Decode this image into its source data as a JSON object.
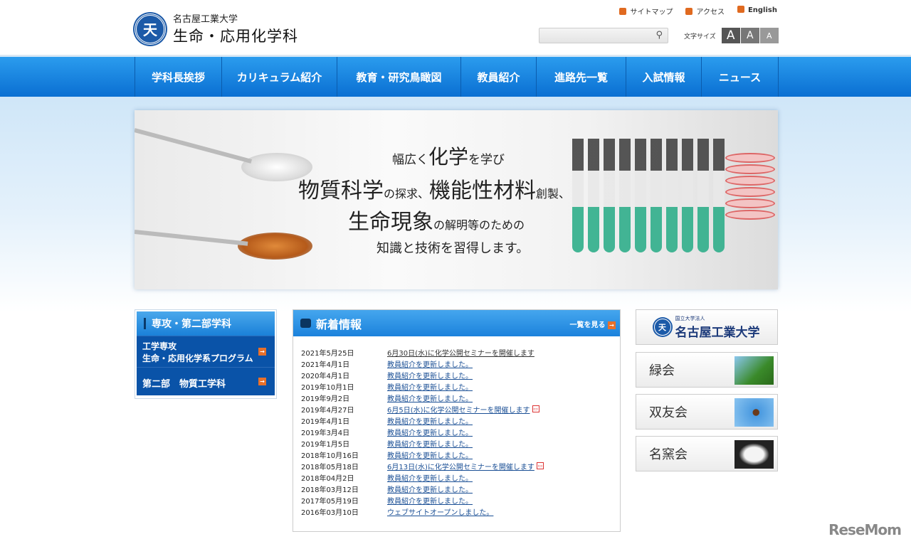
{
  "header": {
    "university": "名古屋工業大学",
    "department": "生命・応用化学科",
    "emblem": "天",
    "links": [
      {
        "label": "サイトマップ",
        "icon": "sitemap-icon"
      },
      {
        "label": "アクセス",
        "icon": "train-icon"
      },
      {
        "label": "English",
        "icon": "arrow-icon"
      }
    ],
    "search_placeholder": "",
    "font_size_label": "文字サイズ",
    "font_sizes": [
      "A",
      "A",
      "A"
    ]
  },
  "nav": [
    "学科長挨拶",
    "カリキュラム紹介",
    "教育・研究鳥瞰図",
    "教員紹介",
    "進路先一覧",
    "入試情報",
    "ニュース"
  ],
  "banner": {
    "line1a": "幅広く",
    "line1b": "化学",
    "line1c": "を学び",
    "line2a": "物質科学",
    "line2b": "の探求、",
    "line2c": "機能性材料",
    "line2d": "創製、",
    "line3a": "生命現象",
    "line3b": "の解明等のための",
    "line4": "知識と技術を習得します。"
  },
  "sidebar": {
    "title": "専攻・第二部学科",
    "items": [
      {
        "line1": "工学専攻",
        "line2": "生命・応用化学系プログラム"
      },
      {
        "line1": "第二部　物質工学科"
      }
    ]
  },
  "news": {
    "title": "新着情報",
    "more": "一覧を見る",
    "items": [
      {
        "date": "2021年5月25日",
        "text": "6月30日(水)に化学公開セミナーを開催します",
        "pdf": false
      },
      {
        "date": "2021年4月1日",
        "text": "教員紹介を更新しました。",
        "pdf": false
      },
      {
        "date": "2020年4月1日",
        "text": "教員紹介を更新しました。",
        "pdf": false
      },
      {
        "date": "2019年10月1日",
        "text": "教員紹介を更新しました。",
        "pdf": false
      },
      {
        "date": "2019年9月2日",
        "text": "教員紹介を更新しました。",
        "pdf": false
      },
      {
        "date": "2019年4月27日",
        "text": "6月5日(水)に化学公開セミナーを開催します",
        "pdf": true
      },
      {
        "date": "2019年4月1日",
        "text": "教員紹介を更新しました。",
        "pdf": false
      },
      {
        "date": "2019年3月4日",
        "text": "教員紹介を更新しました。",
        "pdf": false
      },
      {
        "date": "2019年1月5日",
        "text": "教員紹介を更新しました。",
        "pdf": false
      },
      {
        "date": "2018年10月16日",
        "text": "教員紹介を更新しました。",
        "pdf": false
      },
      {
        "date": "2018年05月18日",
        "text": "6月13日(水)に化学公開セミナーを開催します",
        "pdf": true
      },
      {
        "date": "2018年04月2日",
        "text": "教員紹介を更新しました。",
        "pdf": false
      },
      {
        "date": "2018年03月12日",
        "text": "教員紹介を更新しました。",
        "pdf": false
      },
      {
        "date": "2017年05月19日",
        "text": "教員紹介を更新しました。",
        "pdf": false
      },
      {
        "date": "2016年03月10日",
        "text": "ウェブサイトオープンしました。",
        "pdf": false
      }
    ]
  },
  "right_links": {
    "nitech_small": "国立大学法人",
    "nitech": "名古屋工業大学",
    "items": [
      "緑会",
      "双友会",
      "名窯会"
    ]
  },
  "watermark": "ReseMom"
}
